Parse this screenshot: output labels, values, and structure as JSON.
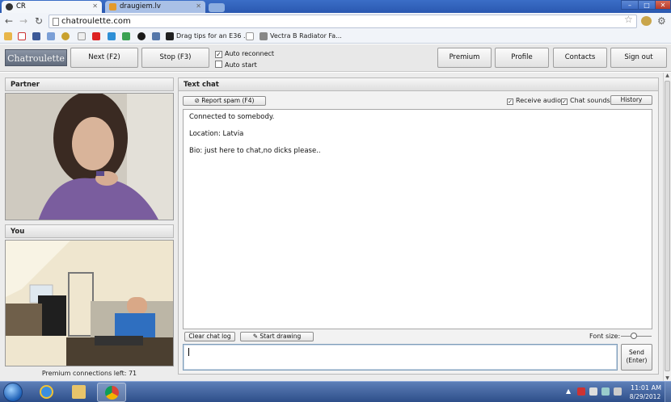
{
  "browser": {
    "tabs": [
      {
        "title": "CR",
        "active": true
      },
      {
        "title": "draugiem.lv",
        "active": false
      }
    ],
    "url": "chatroulette.com",
    "bookmarks": [
      "Drag tips for an E36 ...",
      "Vectra B Radiator Fa..."
    ]
  },
  "site": {
    "logo": "Chatroulette",
    "next_label": "Next (F2)",
    "stop_label": "Stop (F3)",
    "auto_reconnect_label": "Auto reconnect",
    "auto_reconnect_checked": true,
    "auto_start_label": "Auto start",
    "auto_start_checked": false,
    "nav": [
      "Premium",
      "Profile",
      "Contacts",
      "Sign out"
    ]
  },
  "partner": {
    "header": "Partner"
  },
  "you": {
    "header": "You"
  },
  "premium_connections": "Premium connections left: 71",
  "chat": {
    "header": "Text chat",
    "report_label": "Report spam (F4)",
    "receive_audio_label": "Receive audio",
    "chat_sounds_label": "Chat sounds",
    "history_label": "History",
    "messages": [
      "Connected to somebody.",
      "Location: Latvia",
      "Bio: just here to chat,no dicks please.."
    ],
    "clear_label": "Clear chat log",
    "draw_label": "Start drawing",
    "font_size_label": "Font size:",
    "send_label_1": "Send",
    "send_label_2": "(Enter)",
    "input_value": ""
  },
  "taskbar": {
    "time": "11:01 AM",
    "date": "8/29/2012"
  },
  "colors": {
    "tabstrip": "#2a58b0",
    "logo_bg": "#6d7788",
    "taskbar": "#2d4e89"
  }
}
